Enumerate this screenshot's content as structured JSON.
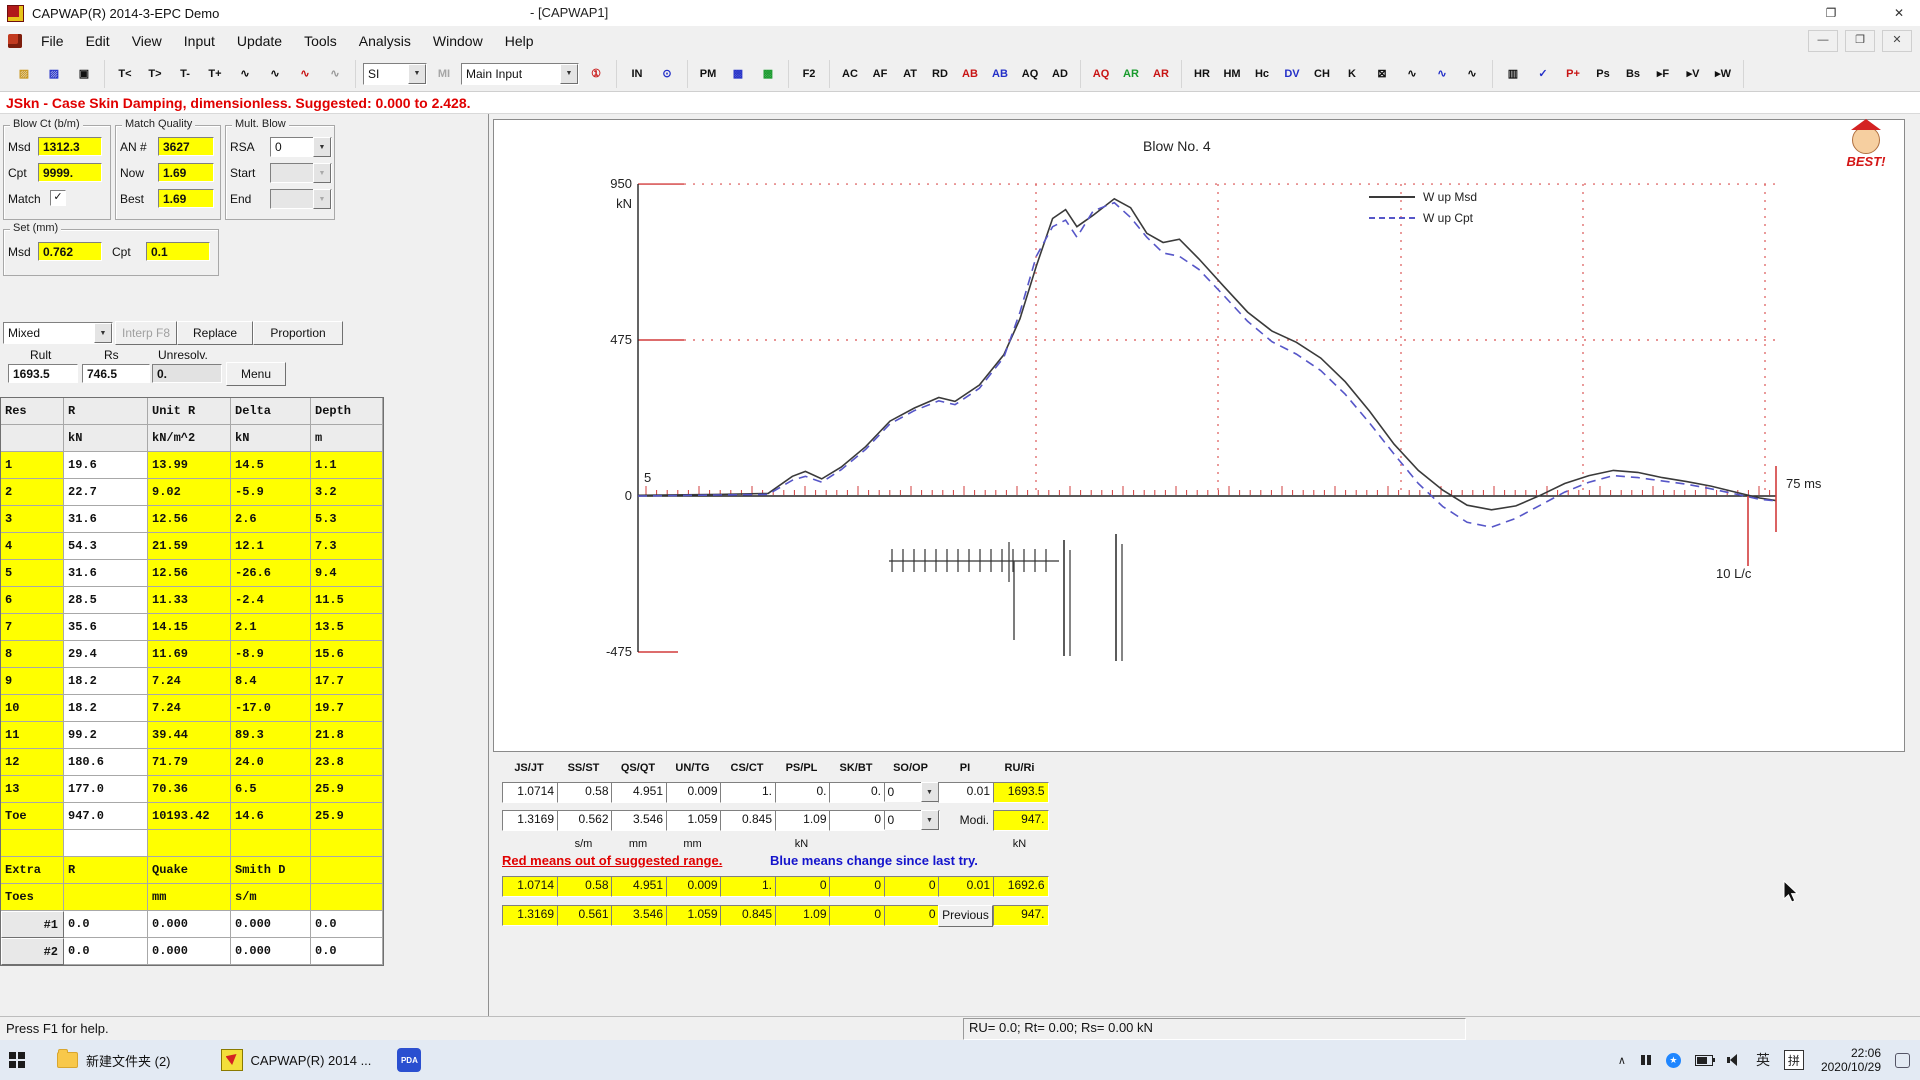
{
  "window": {
    "title": "CAPWAP(R) 2014-3-EPC Demo",
    "doc": "- [CAPWAP1]",
    "restore": "❐",
    "close": "✕"
  },
  "menu": {
    "items": [
      "File",
      "Edit",
      "View",
      "Input",
      "Update",
      "Tools",
      "Analysis",
      "Window",
      "Help"
    ],
    "mdi": [
      "—",
      "❐",
      "✕"
    ]
  },
  "toolbar": {
    "groups": [
      [
        {
          "t": "▨",
          "n": "open-file-button",
          "c": "icon-amber"
        },
        {
          "t": "▨",
          "n": "open-pda-file-button",
          "c": "icon-blue"
        },
        {
          "t": "▣",
          "n": "save-button"
        }
      ],
      [
        {
          "t": "T<",
          "n": "time-shift-left-button"
        },
        {
          "t": "T>",
          "n": "time-shift-right-button"
        },
        {
          "t": "T-",
          "n": "time-minus-button"
        },
        {
          "t": "T+",
          "n": "time-plus-button"
        },
        {
          "t": "∿",
          "n": "wave-a-button"
        },
        {
          "t": "∿",
          "n": "wave-b-button"
        },
        {
          "t": "∿",
          "n": "wave-msd-button",
          "c": "icon-red"
        },
        {
          "t": "∿",
          "n": "wave-cpt-button",
          "c": "icon-dim"
        }
      ],
      [
        {
          "t": "SI",
          "n": "units-select",
          "type": "drop",
          "w": 58
        },
        {
          "t": "MI",
          "n": "mi-button",
          "type": "dis"
        },
        {
          "t": "Main Input",
          "n": "screen-select",
          "type": "drop",
          "w": 112
        },
        {
          "t": "①",
          "n": "warning-icon",
          "c": "icon-red"
        }
      ],
      [
        {
          "t": "IN",
          "n": "input-screen-button"
        },
        {
          "t": "⊙",
          "n": "clock-icon",
          "c": "icon-blue"
        }
      ],
      [
        {
          "t": "PM",
          "n": "pm-button"
        },
        {
          "t": "▩",
          "n": "pile-model-icon",
          "c": "icon-blue"
        },
        {
          "t": "▩",
          "n": "soil-model-icon",
          "c": "icon-green"
        }
      ],
      [
        {
          "t": "F2",
          "n": "f2-button"
        }
      ],
      [
        {
          "t": "AC",
          "n": "ac-button"
        },
        {
          "t": "AF",
          "n": "af-button"
        },
        {
          "t": "AT",
          "n": "at-button"
        },
        {
          "t": "RD",
          "n": "rd-button"
        },
        {
          "t": "AB",
          "n": "ab-red-button",
          "c": "icon-red"
        },
        {
          "t": "AB",
          "n": "ab-blue-button",
          "c": "icon-blue"
        },
        {
          "t": "AQ",
          "n": "aq-button"
        },
        {
          "t": "AD",
          "n": "ad-button"
        }
      ],
      [
        {
          "t": "AQ",
          "n": "aq-stl-button",
          "c": "icon-red"
        },
        {
          "t": "AR",
          "n": "ar-green-button",
          "c": "icon-green"
        },
        {
          "t": "AR",
          "n": "ar-red-button",
          "c": "icon-red"
        }
      ],
      [
        {
          "t": "HR",
          "n": "hr-button"
        },
        {
          "t": "HM",
          "n": "hm-button"
        },
        {
          "t": "Hc",
          "n": "hc-button"
        },
        {
          "t": "DV",
          "n": "dv-button",
          "c": "icon-blue"
        },
        {
          "t": "CH",
          "n": "ch-button"
        },
        {
          "t": "K",
          "n": "k-button"
        },
        {
          "t": "⊠",
          "n": "no-wave-button"
        },
        {
          "t": "∿",
          "n": "wave-x1-button"
        },
        {
          "t": "∿",
          "n": "wave-x2-button",
          "c": "icon-blue"
        },
        {
          "t": "∿",
          "n": "wave-x3-button"
        }
      ],
      [
        {
          "t": "▥",
          "n": "layers-button"
        },
        {
          "t": "✓",
          "n": "check-button",
          "c": "icon-blue"
        },
        {
          "t": "P+",
          "n": "p-plus-button",
          "c": "icon-red"
        },
        {
          "t": "Ps",
          "n": "ps-button"
        },
        {
          "t": "Bs",
          "n": "bs-button"
        },
        {
          "t": "▸F",
          "n": "next-f-button"
        },
        {
          "t": "▸V",
          "n": "next-v-button"
        },
        {
          "t": "▸W",
          "n": "next-w-button"
        }
      ]
    ]
  },
  "suggestion": "JSkn - Case Skin Damping, dimensionless. Suggested: 0.000 to 2.428.",
  "blow_ct": {
    "title": "Blow Ct (b/m)",
    "msd_label": "Msd",
    "msd": "1312.3",
    "cpt_label": "Cpt",
    "cpt": "9999.",
    "match_label": "Match",
    "check": "✓"
  },
  "match_quality": {
    "title": "Match Quality",
    "an_label": "AN #",
    "an": "3627",
    "now_label": "Now",
    "now": "1.69",
    "best_label": "Best",
    "best": "1.69"
  },
  "mult_blow": {
    "title": "Mult. Blow",
    "rsa_label": "RSA",
    "rsa": "0",
    "start_label": "Start",
    "end_label": "End"
  },
  "set_group": {
    "title": "Set (mm)",
    "msd_label": "Msd",
    "msd": "0.762",
    "cpt_label": "Cpt",
    "cpt": "0.1"
  },
  "res_controls": {
    "mode": "Mixed",
    "interp": "Interp F8",
    "replace": "Replace",
    "proportion": "Proportion",
    "rult_label": "Rult",
    "rs_label": "Rs",
    "unresolv_label": "Unresolv.",
    "rult": "1693.5",
    "rs": "746.5",
    "unresolv": "0.",
    "menu": "Menu"
  },
  "res_table": {
    "headers": [
      "Res",
      "R",
      "Unit R",
      "Delta",
      "Depth"
    ],
    "units": [
      "",
      "kN",
      "kN/m^2",
      "kN",
      "m"
    ],
    "rows": [
      [
        "1",
        "19.6",
        "13.99",
        "14.5",
        "1.1"
      ],
      [
        "2",
        "22.7",
        "9.02",
        "-5.9",
        "3.2"
      ],
      [
        "3",
        "31.6",
        "12.56",
        "2.6",
        "5.3"
      ],
      [
        "4",
        "54.3",
        "21.59",
        "12.1",
        "7.3"
      ],
      [
        "5",
        "31.6",
        "12.56",
        "-26.6",
        "9.4"
      ],
      [
        "6",
        "28.5",
        "11.33",
        "-2.4",
        "11.5"
      ],
      [
        "7",
        "35.6",
        "14.15",
        "2.1",
        "13.5"
      ],
      [
        "8",
        "29.4",
        "11.69",
        "-8.9",
        "15.6"
      ],
      [
        "9",
        "18.2",
        "7.24",
        "8.4",
        "17.7"
      ],
      [
        "10",
        "18.2",
        "7.24",
        "-17.0",
        "19.7"
      ],
      [
        "11",
        "99.2",
        "39.44",
        "89.3",
        "21.8"
      ],
      [
        "12",
        "180.6",
        "71.79",
        "24.0",
        "23.8"
      ],
      [
        "13",
        "177.0",
        "70.36",
        "6.5",
        "25.9"
      ],
      [
        "Toe",
        "947.0",
        "10193.42",
        "14.6",
        "25.9"
      ]
    ],
    "extra_headers": [
      "Extra",
      "R",
      "Quake",
      "Smith D",
      ""
    ],
    "extra_sub": [
      "Toes",
      "",
      "mm",
      "s/m",
      ""
    ],
    "extra_rows": [
      [
        "#1",
        "0.0",
        "0.000",
        "0.000",
        "0.0"
      ],
      [
        "#2",
        "0.0",
        "0.000",
        "0.000",
        "0.0"
      ]
    ]
  },
  "chart": {
    "title": "Blow No. 4",
    "y_ticks": [
      "950",
      "475",
      "0",
      "-475"
    ],
    "y_unit": "kN",
    "x_start_label": "5",
    "x_end_label": "75 ms",
    "lc_label": "10 L/c",
    "logo_text": "BEST!",
    "legend": [
      {
        "label": "W up Msd",
        "color": "#3a3a3a",
        "dash": ""
      },
      {
        "label": "W up Cpt",
        "color": "#5656c8",
        "dash": "9,6"
      }
    ]
  },
  "chart_data": {
    "type": "line",
    "title": "Blow No. 4",
    "x_unit": "ms",
    "y_unit": "kN",
    "x_range": [
      5,
      75
    ],
    "ylim": [
      -475,
      950
    ],
    "grid": "red-dotted",
    "legend_position": "top-right",
    "series": [
      {
        "name": "W up Msd",
        "color": "#3a3a3a",
        "dash": "",
        "points": [
          [
            5,
            2
          ],
          [
            10,
            5
          ],
          [
            13,
            8
          ],
          [
            14.5,
            60
          ],
          [
            15.3,
            75
          ],
          [
            16.3,
            52
          ],
          [
            17.5,
            88
          ],
          [
            19,
            150
          ],
          [
            20.5,
            228
          ],
          [
            22,
            268
          ],
          [
            23.5,
            300
          ],
          [
            24.5,
            288
          ],
          [
            26,
            338
          ],
          [
            27.5,
            430
          ],
          [
            28.5,
            540
          ],
          [
            29.5,
            700
          ],
          [
            30.5,
            845
          ],
          [
            31.3,
            872
          ],
          [
            32,
            820
          ],
          [
            33,
            855
          ],
          [
            34.3,
            905
          ],
          [
            35.3,
            878
          ],
          [
            36.3,
            800
          ],
          [
            37.3,
            772
          ],
          [
            38.3,
            782
          ],
          [
            39.5,
            722
          ],
          [
            41,
            640
          ],
          [
            42.5,
            560
          ],
          [
            44,
            502
          ],
          [
            45.5,
            468
          ],
          [
            47,
            420
          ],
          [
            48.5,
            348
          ],
          [
            50,
            258
          ],
          [
            51.5,
            158
          ],
          [
            53,
            78
          ],
          [
            54.5,
            18
          ],
          [
            56,
            -28
          ],
          [
            57.5,
            -42
          ],
          [
            59,
            -30
          ],
          [
            60.5,
            2
          ],
          [
            62,
            38
          ],
          [
            63.5,
            62
          ],
          [
            65,
            78
          ],
          [
            66.5,
            72
          ],
          [
            68,
            56
          ],
          [
            69.5,
            44
          ],
          [
            71,
            30
          ],
          [
            72.5,
            12
          ],
          [
            74,
            -6
          ],
          [
            75,
            -14
          ]
        ]
      },
      {
        "name": "W up Cpt",
        "color": "#5656c8",
        "dash": "9,6",
        "points": [
          [
            5,
            0
          ],
          [
            10,
            3
          ],
          [
            13,
            5
          ],
          [
            14.5,
            48
          ],
          [
            15.3,
            60
          ],
          [
            16.3,
            42
          ],
          [
            17.5,
            80
          ],
          [
            19,
            142
          ],
          [
            20.5,
            220
          ],
          [
            22,
            260
          ],
          [
            23.5,
            290
          ],
          [
            24.5,
            278
          ],
          [
            26,
            328
          ],
          [
            27.5,
            422
          ],
          [
            28.5,
            560
          ],
          [
            29.5,
            730
          ],
          [
            30.5,
            820
          ],
          [
            31.3,
            840
          ],
          [
            32,
            788
          ],
          [
            33,
            868
          ],
          [
            34.3,
            893
          ],
          [
            35.3,
            848
          ],
          [
            36.3,
            788
          ],
          [
            37.3,
            740
          ],
          [
            38.3,
            730
          ],
          [
            39.5,
            690
          ],
          [
            41,
            612
          ],
          [
            42.5,
            532
          ],
          [
            44,
            470
          ],
          [
            45.5,
            432
          ],
          [
            47,
            382
          ],
          [
            48.5,
            310
          ],
          [
            50,
            222
          ],
          [
            51.5,
            128
          ],
          [
            53,
            38
          ],
          [
            54.5,
            -32
          ],
          [
            56,
            -80
          ],
          [
            57.5,
            -95
          ],
          [
            59,
            -68
          ],
          [
            60.5,
            -28
          ],
          [
            62,
            12
          ],
          [
            63.5,
            42
          ],
          [
            65,
            62
          ],
          [
            66.5,
            56
          ],
          [
            68,
            46
          ],
          [
            69.5,
            36
          ],
          [
            71,
            22
          ],
          [
            72.5,
            6
          ],
          [
            74,
            -10
          ],
          [
            75,
            -15
          ]
        ]
      }
    ]
  },
  "param_grid": {
    "headers": [
      "JS/JT",
      "SS/ST",
      "QS/QT",
      "UN/TG",
      "CS/CT",
      "PS/PL",
      "SK/BT",
      "SO/OP",
      "PI",
      "RU/Ri"
    ],
    "row1": [
      "1.0714",
      "0.58",
      "4.951",
      "0.009",
      "1.",
      "0.",
      "0.",
      "0",
      "0.01",
      "1693.5"
    ],
    "row2": [
      "1.3169",
      "0.562",
      "3.546",
      "1.059",
      "0.845",
      "1.09",
      "0",
      "0",
      "Modi.",
      "947."
    ],
    "units": [
      "",
      "s/m",
      "mm",
      "mm",
      "",
      "kN",
      "",
      "",
      "",
      "kN"
    ],
    "red_note": "Red means out of suggested range.",
    "blue_note": "Blue means change since last try.",
    "row3": [
      "1.0714",
      "0.58",
      "4.951",
      "0.009",
      "1.",
      "0",
      "0",
      "0",
      "0.01",
      "1692.6"
    ],
    "row4": [
      "1.3169",
      "0.561",
      "3.546",
      "1.059",
      "0.845",
      "1.09",
      "0",
      "0",
      "Previous",
      "947."
    ]
  },
  "status": {
    "help": "Press F1 for help.",
    "values": "RU= 0.0; Rt= 0.00; Rs= 0.00 kN"
  },
  "taskbar": {
    "folder": "新建文件夹 (2)",
    "app": "CAPWAP(R) 2014 ...",
    "pda": "PDA",
    "lang": "英",
    "pinyin": "拼",
    "time": "22:06",
    "date": "2020/10/29",
    "star": "★",
    "chevron": "∧"
  }
}
